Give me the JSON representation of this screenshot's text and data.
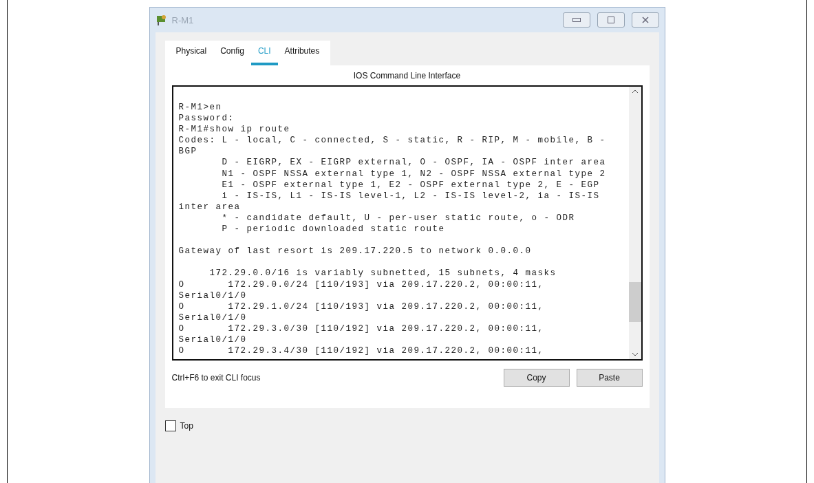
{
  "window": {
    "title": "R-M1"
  },
  "tabs": [
    {
      "label": "Physical",
      "selected": false
    },
    {
      "label": "Config",
      "selected": false
    },
    {
      "label": "CLI",
      "selected": true
    },
    {
      "label": "Attributes",
      "selected": false
    }
  ],
  "panel_title": "IOS Command Line Interface",
  "terminal_blocks": [
    [
      "R-M1>en",
      "Password:",
      "R-M1#show ip route",
      "Codes: L - local, C - connected, S - static, R - RIP, M - mobile, B -",
      "BGP",
      "       D - EIGRP, EX - EIGRP external, O - OSPF, IA - OSPF inter area",
      "       N1 - OSPF NSSA external type 1, N2 - OSPF NSSA external type 2",
      "       E1 - OSPF external type 1, E2 - OSPF external type 2, E - EGP",
      "       i - IS-IS, L1 - IS-IS level-1, L2 - IS-IS level-2, ia - IS-IS",
      "inter area",
      "       * - candidate default, U - per-user static route, o - ODR",
      "       P - periodic downloaded static route"
    ],
    [
      "Gateway of last resort is 209.17.220.5 to network 0.0.0.0"
    ],
    [
      "     172.29.0.0/16 is variably subnetted, 15 subnets, 4 masks",
      "O       172.29.0.0/24 [110/193] via 209.17.220.2, 00:00:11,",
      "Serial0/1/0",
      "O       172.29.1.0/24 [110/193] via 209.17.220.2, 00:00:11,",
      "Serial0/1/0",
      "O       172.29.3.0/30 [110/192] via 209.17.220.2, 00:00:11,",
      "Serial0/1/0",
      "O       172.29.3.4/30 [110/192] via 209.17.220.2, 00:00:11,"
    ]
  ],
  "hint": "Ctrl+F6 to exit CLI focus",
  "buttons": [
    "Copy",
    "Paste"
  ],
  "top_checkbox": {
    "label": "Top",
    "checked": false
  }
}
